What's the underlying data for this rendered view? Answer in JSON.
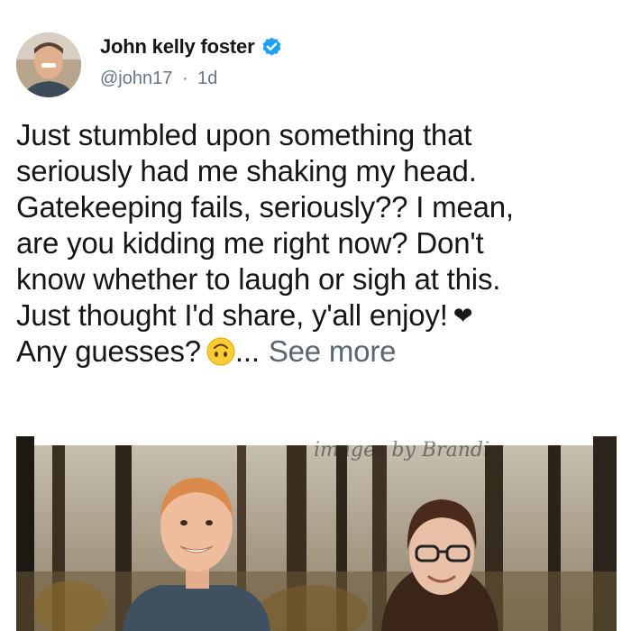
{
  "author": {
    "display_name": "John kelly foster",
    "handle": "@john17",
    "separator": "·",
    "time": "1d",
    "verified": true,
    "avatar_icon": "profile-photo"
  },
  "post": {
    "lines": [
      "Just stumbled upon something that",
      "seriously had me shaking my head.",
      "Gatekeeping fails, seriously?? I mean,",
      "are you kidding me right now? Don't",
      "know whether to laugh or sigh at this.",
      "Just thought I'd share, y'all enjoy!",
      "Any guesses?"
    ],
    "heart_glyph": "❤",
    "ellipsis": "...",
    "see_more_label": "See more"
  },
  "media": {
    "watermark": "images by Brandi",
    "description_icon": "couple-photo"
  },
  "colors": {
    "verified_blue": "#1da1f2",
    "text_primary": "#14171a",
    "text_secondary": "#657786"
  }
}
